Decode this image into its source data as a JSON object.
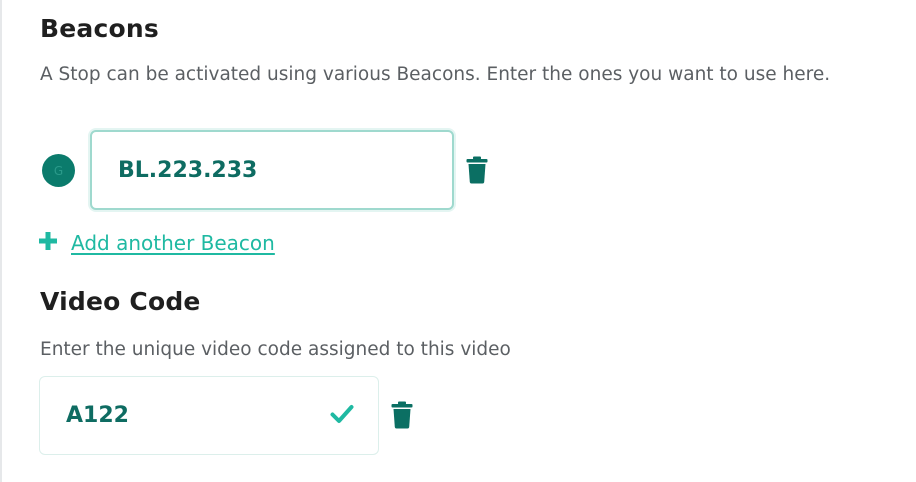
{
  "beacons": {
    "title": "Beacons",
    "description": "A Stop can be activated using various Beacons. Enter the ones you want to use here.",
    "avatar_letter": "G",
    "items": [
      {
        "value": "BL.223.233"
      }
    ],
    "add_label": "Add another Beacon"
  },
  "video_code": {
    "title": "Video Code",
    "description": "Enter the unique video code assigned to this video",
    "value": "A122"
  },
  "icons": {
    "delete": "trash-icon",
    "add": "plus-icon",
    "valid": "check-icon"
  },
  "colors": {
    "accent": "#1fb9a2",
    "text_value": "#0e6c62",
    "avatar": "#0b7b6c",
    "focus_border": "#9fd9ce"
  }
}
